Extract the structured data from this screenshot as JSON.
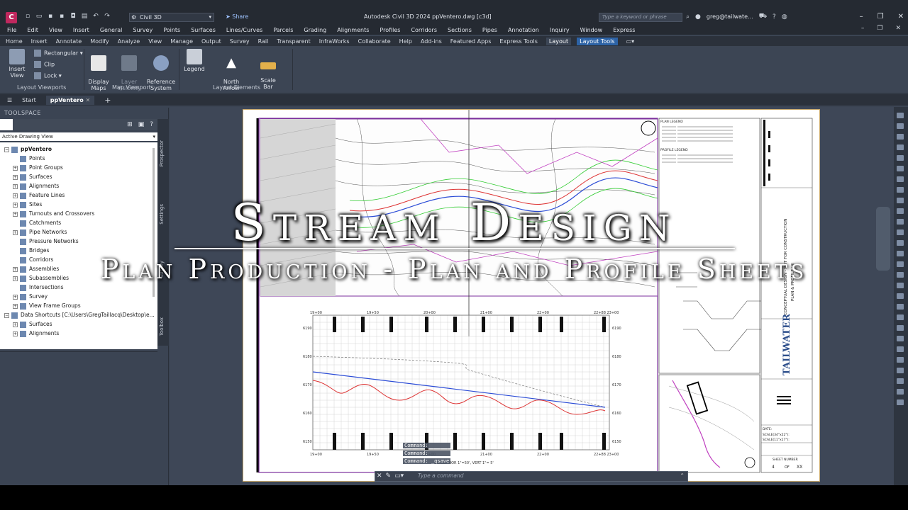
{
  "titlebar": {
    "app_logo": "C",
    "workspace": "Civil 3D",
    "share": "Share",
    "window_title": "Autodesk Civil 3D 2024   ppVentero.dwg [c3d]",
    "search_placeholder": "Type a keyword or phrase",
    "user": "greg@tailwate..."
  },
  "menubar": [
    "File",
    "Edit",
    "View",
    "Insert",
    "General",
    "Survey",
    "Points",
    "Surfaces",
    "Lines/Curves",
    "Parcels",
    "Grading",
    "Alignments",
    "Profiles",
    "Corridors",
    "Sections",
    "Pipes",
    "Annotation",
    "Inquiry",
    "Window",
    "Express"
  ],
  "ribbon_tabs": [
    "Home",
    "Insert",
    "Annotate",
    "Modify",
    "Analyze",
    "View",
    "Manage",
    "Output",
    "Survey",
    "Rail",
    "Transparent",
    "InfraWorks",
    "Collaborate",
    "Help",
    "Add-ins",
    "Featured Apps",
    "Express Tools",
    "Layout",
    "Layout Tools"
  ],
  "ribbon": {
    "insert_view": "Insert View",
    "rectangular": "Rectangular",
    "clip": "Clip",
    "lock": "Lock",
    "display_maps": "Display\nMaps",
    "layer_visibility": "Layer\nVisibility",
    "reference_system": "Reference\nSystem",
    "legend": "Legend",
    "north_arrow": "North\nArrow",
    "scale_bar": "Scale\nBar",
    "panel_layout_viewports": "Layout Viewports",
    "panel_map_viewport": "Map Viewport",
    "panel_layout_elements": "Layout Elements"
  },
  "filetabs": {
    "start": "Start",
    "active": "ppVentero"
  },
  "toolspace": {
    "title": "TOOLSPACE",
    "view_select": "Active Drawing View",
    "tree": [
      {
        "label": "ppVentero",
        "level": 0,
        "root": true,
        "expander": "−"
      },
      {
        "label": "Points",
        "level": 1,
        "expander": ""
      },
      {
        "label": "Point Groups",
        "level": 1,
        "expander": "+"
      },
      {
        "label": "Surfaces",
        "level": 1,
        "expander": "+"
      },
      {
        "label": "Alignments",
        "level": 1,
        "expander": "+"
      },
      {
        "label": "Feature Lines",
        "level": 1,
        "expander": "+"
      },
      {
        "label": "Sites",
        "level": 1,
        "expander": "+"
      },
      {
        "label": "Turnouts and Crossovers",
        "level": 1,
        "expander": "+"
      },
      {
        "label": "Catchments",
        "level": 1,
        "expander": ""
      },
      {
        "label": "Pipe Networks",
        "level": 1,
        "expander": "+"
      },
      {
        "label": "Pressure Networks",
        "level": 1,
        "expander": ""
      },
      {
        "label": "Bridges",
        "level": 1,
        "expander": ""
      },
      {
        "label": "Corridors",
        "level": 1,
        "expander": ""
      },
      {
        "label": "Assemblies",
        "level": 1,
        "expander": "+"
      },
      {
        "label": "Subassemblies",
        "level": 1,
        "expander": "+"
      },
      {
        "label": "Intersections",
        "level": 1,
        "expander": ""
      },
      {
        "label": "Survey",
        "level": 1,
        "expander": "+"
      },
      {
        "label": "View Frame Groups",
        "level": 1,
        "expander": "+"
      },
      {
        "label": "Data Shortcuts [C:\\Users\\GregTaillacq\\Desktop\\e...",
        "level": 0,
        "root": false,
        "expander": "−"
      },
      {
        "label": "Surfaces",
        "level": 1,
        "expander": "+"
      },
      {
        "label": "Alignments",
        "level": 1,
        "expander": "+"
      }
    ],
    "vtabs": [
      "Prospector",
      "Settings",
      "Survey",
      "Toolbox"
    ]
  },
  "overlay": {
    "title": "Stream Design",
    "subtitle": "Plan Production - Plan and Profile Sheets"
  },
  "sheet": {
    "legend_plan": "PLAN LEGEND",
    "legend_profile": "PROFILE LEGEND",
    "brand": "TAILWATER",
    "date_label": "DATE:",
    "scale1": "SCALE(34\"x22\"):",
    "scale2": "SCALE(11\"x17\"):",
    "sheet_number": "SHEET NUMBER",
    "sheet_num_val": "4",
    "sheet_of": "OF",
    "sheet_total": "XX",
    "title_vertical": "CONCEPTUAL DESIGN - NOT FOR CONSTRUCTION",
    "profile_vertical": "PLAN & PROFILE (4)",
    "station_labels_top": [
      "19+00",
      "19+50",
      "20+00",
      "21+00",
      "22+00",
      "22+88 23+00"
    ],
    "station_labels_bottom": [
      "19+00",
      "19+50",
      "20+00",
      "21+00",
      "22+00",
      "22+88 23+00"
    ],
    "elev_labels": [
      "6190",
      "6180",
      "6170",
      "6160",
      "6150"
    ],
    "profile_scale": "SCALE: HOR 1\"=50', VERT 1\"= 5'"
  },
  "command": {
    "history": [
      "Command:",
      "Command:",
      "Command: _qsave"
    ],
    "placeholder": "Type a command"
  }
}
